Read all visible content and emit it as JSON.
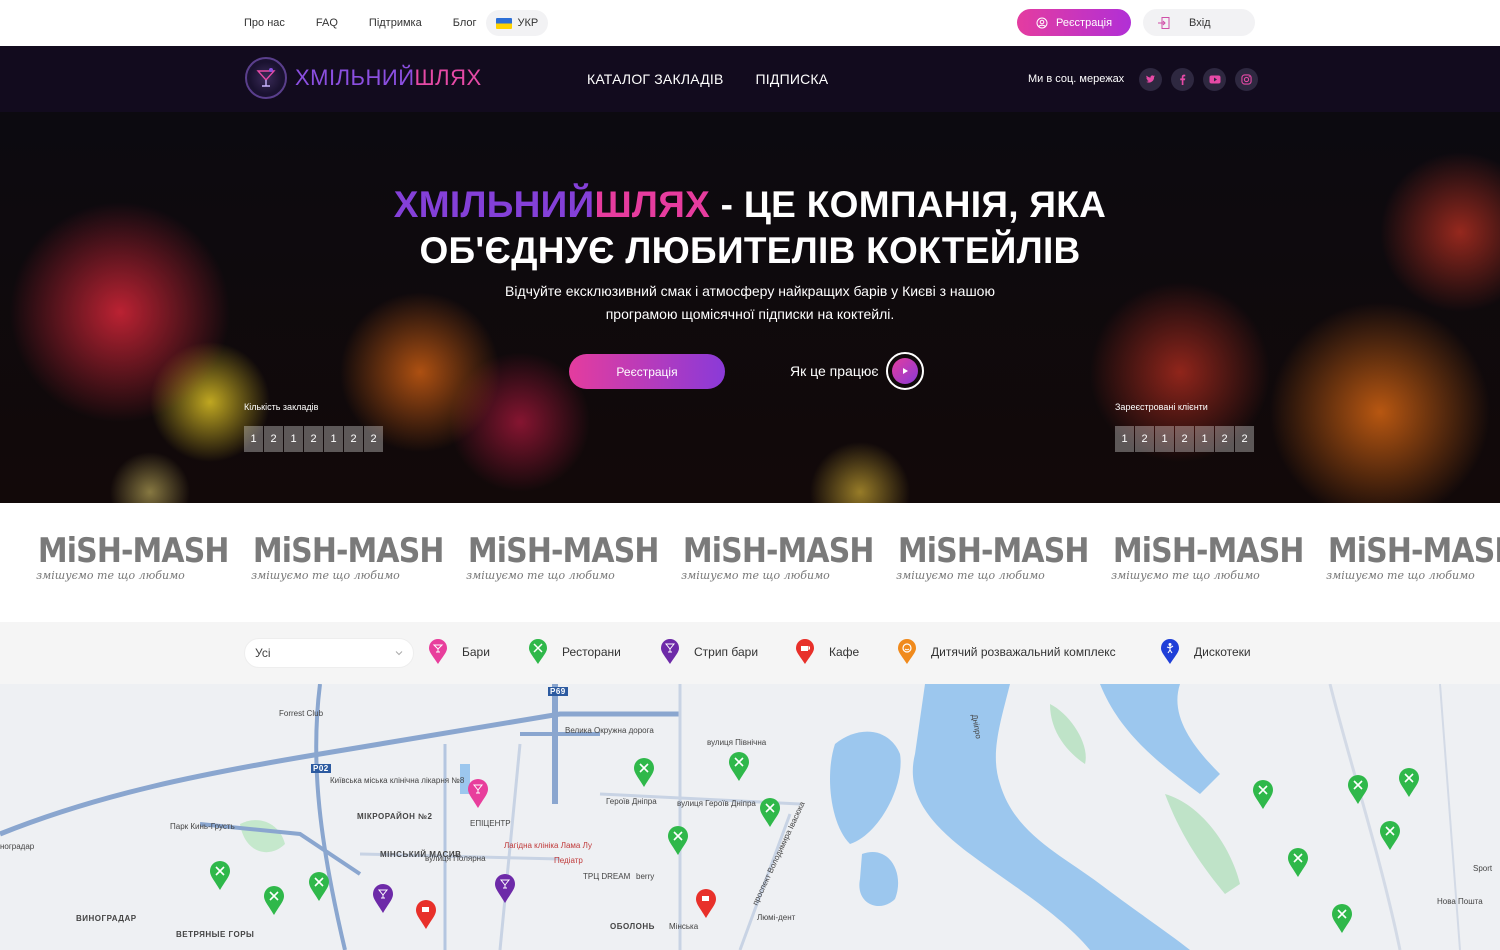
{
  "topbar": {
    "links": [
      "Про нас",
      "FAQ",
      "Підтримка",
      "Блог"
    ],
    "language": "УКР",
    "register_label": "Реєстрація",
    "login_label": "Вхід"
  },
  "header": {
    "logo_part1": "ХМІЛЬНИЙ",
    "logo_part2": "ШЛЯХ",
    "nav": [
      "КАТАЛОГ ЗАКЛАДІВ",
      "ПІДПИСКА"
    ],
    "social_label": "Ми в соц. мережах",
    "socials": [
      "twitter-icon",
      "facebook-icon",
      "youtube-icon",
      "instagram-icon"
    ]
  },
  "hero": {
    "title_brand_a": "ХМІЛЬНИЙ",
    "title_brand_b": "ШЛЯХ",
    "title_line1_rest": " - ЦЕ КОМПАНІЯ, ЯКА",
    "title_line2": "ОБ'ЄДНУЄ ЛЮБИТЕЛІВ КОКТЕЙЛІВ",
    "subtitle_line1": "Відчуйте ексклюзивний смак і атмосферу найкращих барів у Києві з нашою",
    "subtitle_line2": "програмою щомісячної підписки на коктейлі.",
    "register_label": "Реєстрація",
    "how_label": "Як це працює",
    "venues_label": "Кількість закладів",
    "venues_digits": [
      "1",
      "2",
      "1",
      "2",
      "1",
      "2",
      "2"
    ],
    "clients_label": "Зареєстровані клієнти",
    "clients_digits": [
      "1",
      "2",
      "1",
      "2",
      "1",
      "2",
      "2"
    ]
  },
  "partners": {
    "name": "MiSH-MASH",
    "tagline": "змішуємо те що любимо",
    "count": 7
  },
  "filters": {
    "select_value": "Усі",
    "categories": [
      {
        "label": "Бари",
        "color": "#e83e9c"
      },
      {
        "label": "Ресторани",
        "color": "#2fb84a"
      },
      {
        "label": "Стрип бари",
        "color": "#6d2aa8"
      },
      {
        "label": "Кафе",
        "color": "#e8302a"
      },
      {
        "label": "Дитячий розважальний комплекс",
        "color": "#f08a1c"
      },
      {
        "label": "Дискотеки",
        "color": "#1f3fd8"
      }
    ]
  },
  "map": {
    "labels": [
      "Forrest Club",
      "Київська міська клінічна лікарня №8",
      "Парк Кинь-Грусть",
      "МІКРОРАЙОН №2",
      "ЕПІЦЕНТР",
      "Лагідна клініка Лама Лу",
      "Педіатр",
      "МІНСЬКИЙ МАСИВ",
      "вулиця Полярна",
      "ВИНОГРАДАР",
      "ВЕТРЯНЫЕ ГОРЫ",
      "ТРЦ DREAM",
      "berry",
      "ОБОЛОНЬ",
      "Мінська",
      "Люмі-дент",
      "вулиця Північна",
      "Героїв Дніпра",
      "вулиця Героїв Дніпра",
      "Дніпро",
      "Велика Окружна дорога",
      "Sport",
      "Нова Пошта",
      "Р69",
      "Р02",
      "проспект Володимира Івасюка",
      "ноградар"
    ]
  }
}
